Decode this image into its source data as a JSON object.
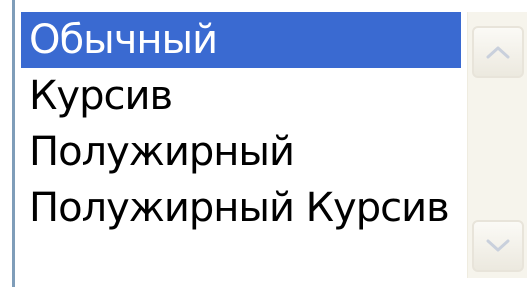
{
  "font_style_list": {
    "items": [
      {
        "label": "Обычный",
        "selected": true
      },
      {
        "label": "Курсив",
        "selected": false
      },
      {
        "label": "Полужирный",
        "selected": false
      },
      {
        "label": "Полужирный Курсив",
        "selected": false
      }
    ],
    "selection_color": "#3a6ad1"
  },
  "scrollbar": {
    "up_icon": "chevron-up-icon",
    "down_icon": "chevron-down-icon"
  }
}
